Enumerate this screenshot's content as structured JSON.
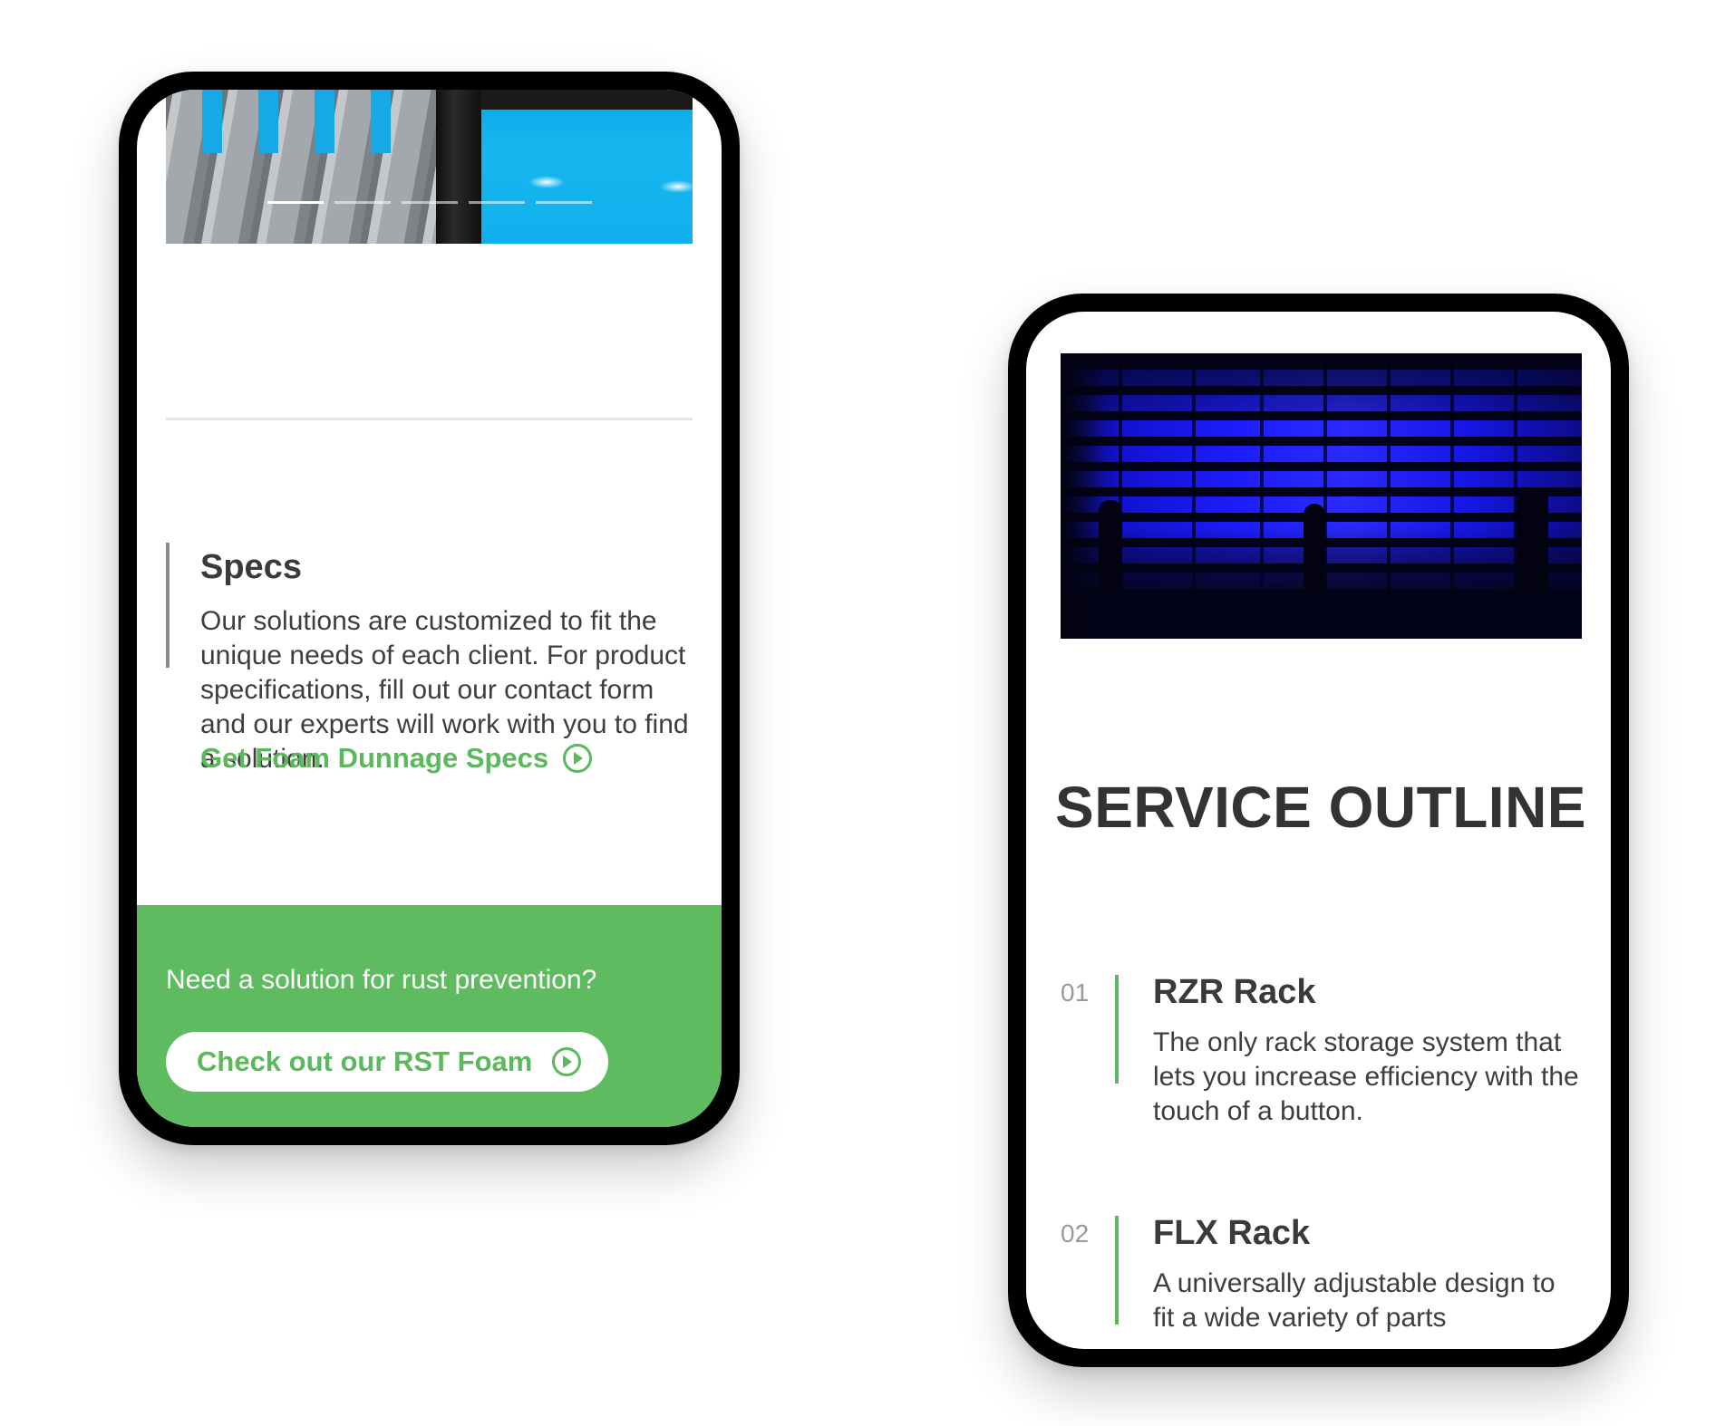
{
  "left_phone": {
    "carousel": {
      "slide_count": 5,
      "active_index": 0
    },
    "specs": {
      "title": "Specs",
      "body": "Our solutions are customized to fit the unique needs of each client. For product specifications, fill out our contact form and our experts will work with you to find a solution.",
      "link_label": "Get Foam Dunnage Specs",
      "link_icon": "play-circle-icon"
    },
    "cta": {
      "question": "Need a solution for rust prevention?",
      "button_label": "Check out our RST Foam",
      "button_icon": "play-circle-icon"
    }
  },
  "right_phone": {
    "title": "SERVICE OUTLINE",
    "services": [
      {
        "number": "01",
        "name": "RZR Rack",
        "description": "The only rack storage system that lets you increase efficiency with the touch of a button."
      },
      {
        "number": "02",
        "name": "FLX Rack",
        "description": "A universally adjustable design to fit a wide variety of parts"
      }
    ]
  },
  "colors": {
    "accent_green": "#5cb85c",
    "cta_background": "#5fbb5f",
    "text_dark": "#333333",
    "number_gray": "#9a9a9a"
  }
}
